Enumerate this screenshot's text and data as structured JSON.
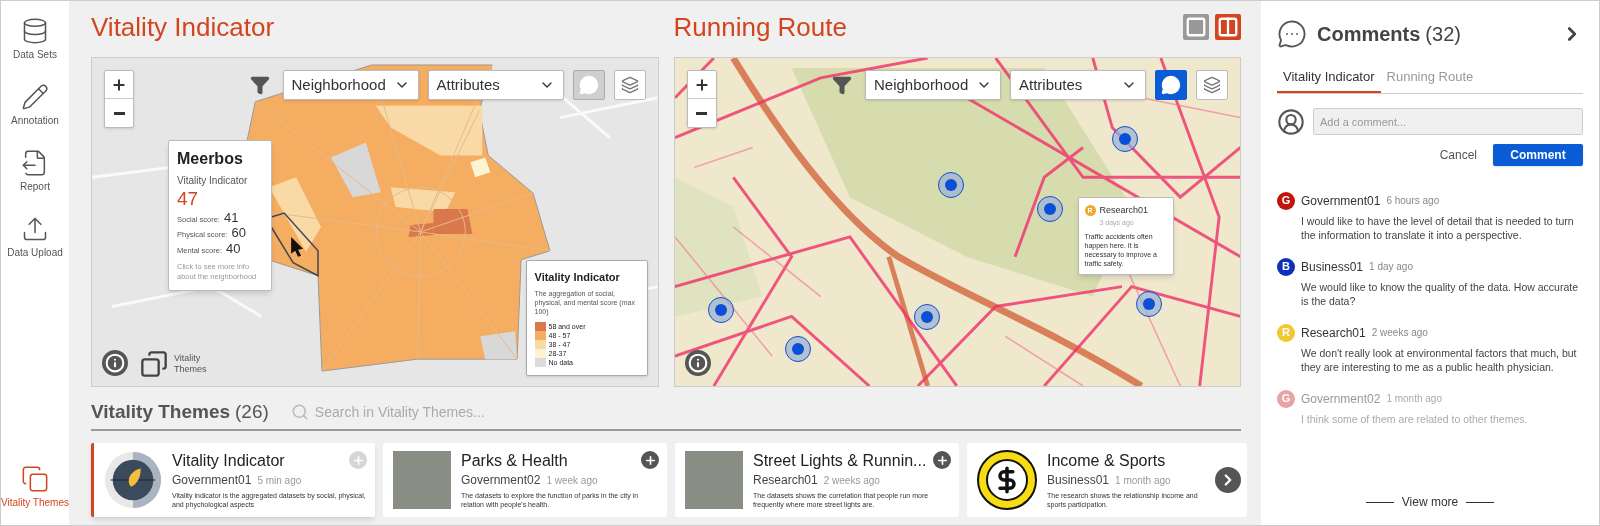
{
  "sidebar": {
    "items": [
      {
        "label": "Data Sets",
        "selected": false
      },
      {
        "label": "Annotation",
        "selected": false
      },
      {
        "label": "Report",
        "selected": false
      },
      {
        "label": "Data Upload",
        "selected": false
      }
    ],
    "bottom_items": [
      {
        "label": "Vitality Themes",
        "selected": true
      }
    ]
  },
  "panels": [
    {
      "title": "Vitality Indicator",
      "kind": "choropleth",
      "neighborhood": "Neighborhood",
      "attributes": "Attributes",
      "comments_on": false,
      "popup": {
        "title": "Meerbos",
        "metric": "Vitality Indicator",
        "value": "47",
        "scores": [
          {
            "label": "Social score:",
            "value": "41"
          },
          {
            "label": "Physical score:",
            "value": "60"
          },
          {
            "label": "Mental score:",
            "value": "40"
          }
        ],
        "hint": "Click to see more info about the neighborhood"
      },
      "legend": {
        "title": "Vitality Indicator",
        "description": "The aggregation of social, physical, and mental score (max 100)",
        "items": [
          {
            "label": "58 and over",
            "color": "#d9784a"
          },
          {
            "label": "48 - 57",
            "color": "#f5ad62"
          },
          {
            "label": "38 - 47",
            "color": "#f9d9a5"
          },
          {
            "label": "28-37",
            "color": "#fcf5d3"
          },
          {
            "label": "No data",
            "color": "#dcdcdc"
          }
        ]
      },
      "themes_toggle": "Vitality Themes"
    },
    {
      "title": "Running Route",
      "kind": "route",
      "neighborhood": "Neighborhood",
      "attributes": "Attributes",
      "comments_on": true,
      "view_modes": [
        {
          "selected": false
        },
        {
          "selected": true
        }
      ],
      "note": {
        "initial": "R",
        "color": "#f0a830",
        "author": "Research01",
        "time": "3 days ago",
        "text": "Traffic accidents often happen here. It is necessary to improve a traffic safety."
      }
    }
  ],
  "themes": {
    "title": "Vitality Themes",
    "count": "(26)",
    "search_placeholder": "Search in Vitality Themes...",
    "cards": [
      {
        "title": "Vitality Indicator",
        "author": "Government01",
        "time": "5 min ago",
        "description": "Vitality indicator is the aggregated datasets by social, physical, and phychological aspects",
        "kind": "dial",
        "selected": true
      },
      {
        "title": "Parks & Health",
        "author": "Government02",
        "time": "1 week ago",
        "description": "The datasets to explore the function of parks in the city in relation with people's health.",
        "kind": "photo",
        "selected": false
      },
      {
        "title": "Street Lights & Runnin...",
        "author": "Research01",
        "time": "2 weeks ago",
        "description": "The datasets shows the correlation that people run more frequently where more street lights are.",
        "kind": "photo",
        "selected": false
      },
      {
        "title": "Income & Sports",
        "author": "Business01",
        "time": "1 month ago",
        "description": "The research shows the relationship income and sports participation.",
        "kind": "coin",
        "selected": false
      }
    ]
  },
  "comments": {
    "title": "Comments",
    "count": "(32)",
    "tabs": [
      {
        "label": "Vitality Indicator",
        "selected": true
      },
      {
        "label": "Running Route",
        "selected": false
      }
    ],
    "input_placeholder": "Add a comment...",
    "cancel": "Cancel",
    "submit": "Comment",
    "items": [
      {
        "initial": "G",
        "color": "#c0140f",
        "author": "Government01",
        "time": "6 hours ago",
        "text": "I would like to have the level of detail that is needed to turn the information to translate it into a perspective.",
        "faded": false
      },
      {
        "initial": "B",
        "color": "#1030b8",
        "author": "Business01",
        "time": "1 day ago",
        "text": "We would like to know the quality of the data. How accurate is the data?",
        "faded": false
      },
      {
        "initial": "R",
        "color": "#f0c830",
        "author": "Research01",
        "time": "2 weeks ago",
        "text": "We don't really look at environmental factors that much, but they are interesting to me as a public health physician.",
        "faded": false
      },
      {
        "initial": "G",
        "color": "#e8a4a4",
        "author": "Government02",
        "time": "1 month ago",
        "text": "I think some of them are related to other themes.",
        "faded": true
      }
    ],
    "view_more": "View more"
  }
}
